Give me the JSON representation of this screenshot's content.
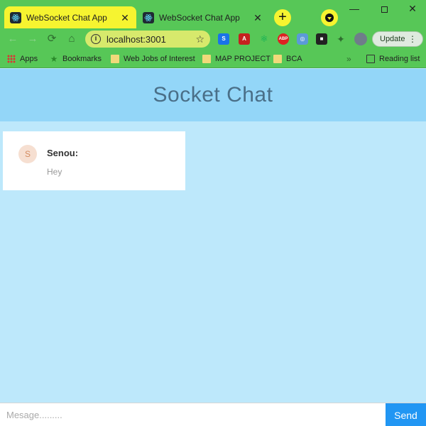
{
  "browser": {
    "tabs": [
      {
        "title": "WebSocket Chat App",
        "active": true
      },
      {
        "title": "WebSocket Chat App",
        "active": false
      }
    ],
    "url": "localhost:3001",
    "update_label": "Update",
    "bookmarks": [
      "Apps",
      "Bookmarks",
      "Web Jobs of Interest",
      "MAP PROJECT",
      "BCA"
    ],
    "reading_list_label": "Reading list",
    "colors": {
      "frame": "#57c757",
      "active_tab": "#f6f430",
      "omnibox": "#d7e96c"
    }
  },
  "app": {
    "title": "Socket Chat",
    "messages": [
      {
        "avatar_initial": "S",
        "sender": "Senou:",
        "text": "Hey"
      }
    ],
    "composer": {
      "placeholder": "Mesage.........",
      "value": "",
      "send_label": "Send"
    },
    "colors": {
      "header": "#93d6f8",
      "background": "#bde8fb",
      "send_button": "#2196f3"
    }
  }
}
